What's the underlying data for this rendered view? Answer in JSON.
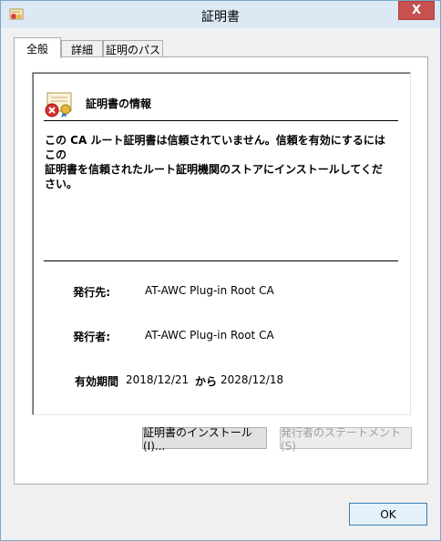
{
  "window": {
    "title": "証明書",
    "close_glyph": "X",
    "icon": "certificate-icon"
  },
  "tabs": [
    {
      "label": "全般",
      "active": true
    },
    {
      "label": "詳細",
      "active": false
    },
    {
      "label": "証明のパス",
      "active": false
    }
  ],
  "general": {
    "info_title": "証明書の情報",
    "warning_line1": "この CA ルート証明書は信頼されていません。信頼を有効にするにはこの",
    "warning_line2": "証明書を信頼されたルート証明機関のストアにインストールしてください。",
    "issued_to_label": "発行先:",
    "issued_to_value": "AT-AWC Plug-in Root CA",
    "issued_by_label": "発行者:",
    "issued_by_value": "AT-AWC Plug-in Root CA",
    "validity_label": "有効期間",
    "valid_from": "2018/12/21",
    "valid_sep": "から",
    "valid_to": "2028/12/18"
  },
  "buttons": {
    "install": "証明書のインストール(I)...",
    "issuer_statement": "発行者のステートメント(S)",
    "ok": "OK"
  },
  "colors": {
    "title_bar": "#dce9f5",
    "close_button": "#c75050",
    "window_border": "#7aa6c8"
  }
}
